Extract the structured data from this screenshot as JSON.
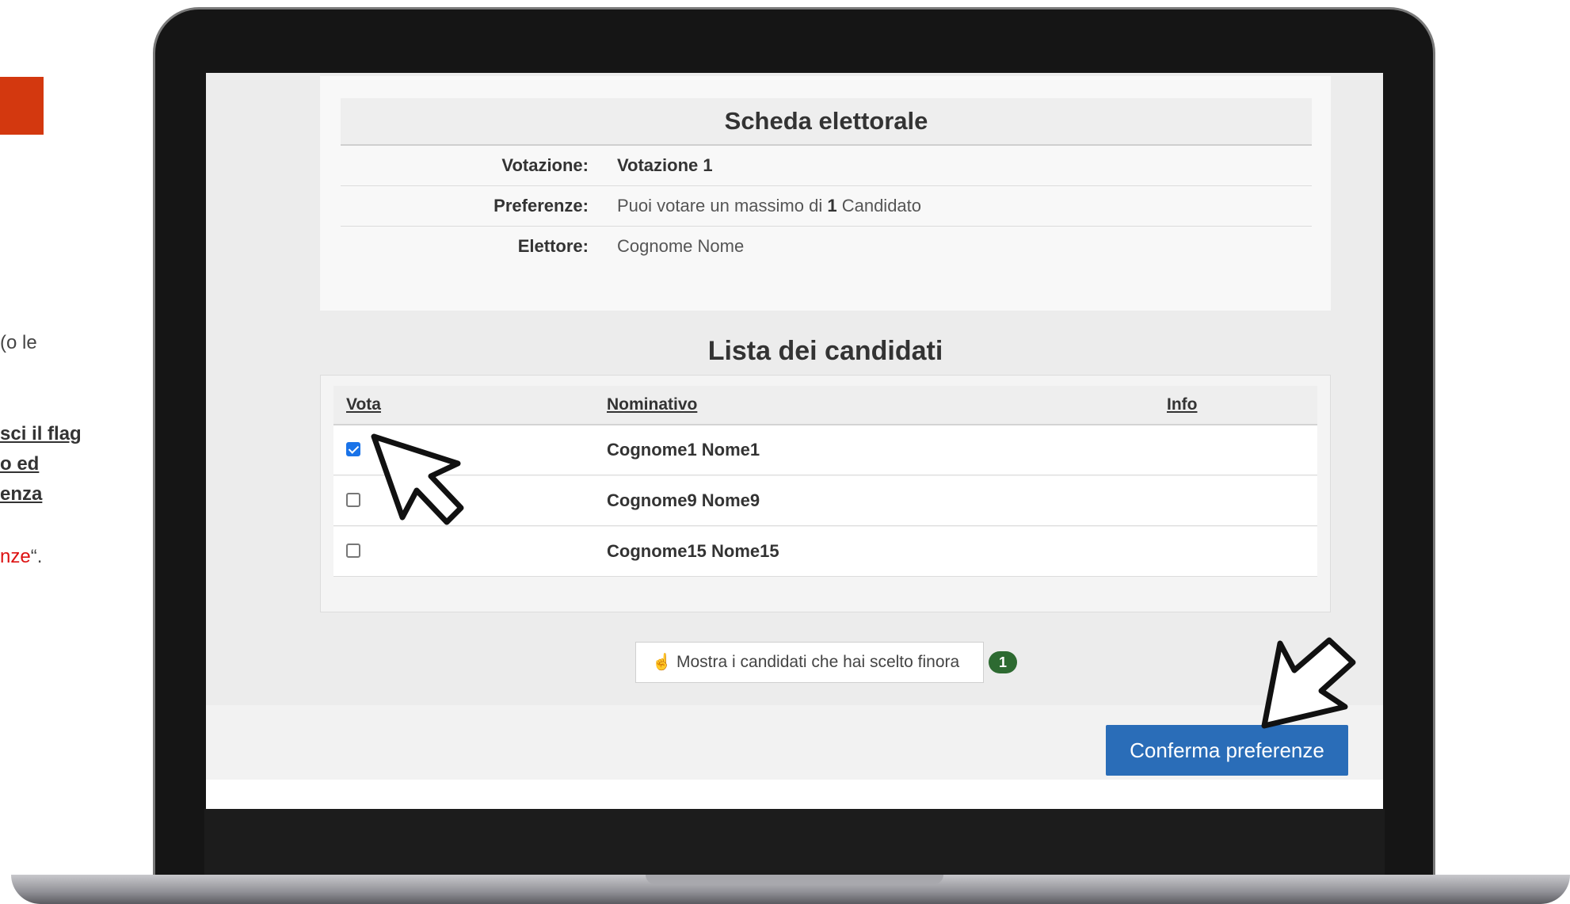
{
  "left_panel": {
    "line1": "(o le",
    "line2": "sci il flag",
    "line3": "o ed",
    "line4": "enza",
    "line5_red": "nze",
    "line5_tail": "“."
  },
  "ballot": {
    "title": "Scheda elettorale",
    "rows": [
      {
        "label": "Votazione:",
        "value": "Votazione 1"
      },
      {
        "label": "Preferenze:",
        "value_prefix": "Puoi votare un massimo di ",
        "value_bold": "1",
        "value_suffix": " Candidato"
      },
      {
        "label": "Elettore:",
        "value": "Cognome Nome"
      }
    ]
  },
  "candidates": {
    "title": "Lista dei candidati",
    "columns": [
      "Vota",
      "Nominativo",
      "Info"
    ],
    "rows": [
      {
        "name": "Cognome1 Nome1",
        "checked": true
      },
      {
        "name": "Cognome9 Nome9",
        "checked": false
      },
      {
        "name": "Cognome15 Nome15",
        "checked": false
      }
    ]
  },
  "show_chosen_button": {
    "icon": "hand-pointer-icon",
    "label": "Mostra i candidati che hai scelto finora",
    "count": "1"
  },
  "confirm_button": {
    "label": "Conferma preferenze"
  },
  "colors": {
    "accent_block": "#d3380f",
    "confirm": "#2a6db8",
    "badge": "#2d6a31",
    "check": "#1a73e8"
  }
}
